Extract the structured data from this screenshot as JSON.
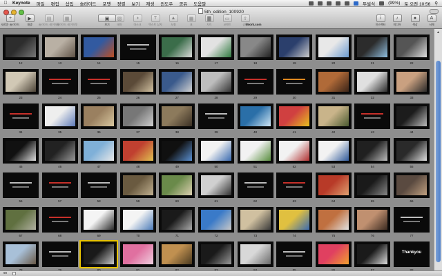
{
  "menubar": {
    "app": "Keynote",
    "items": [
      "파일",
      "편집",
      "삽입",
      "슬라이드",
      "포맷",
      "정렬",
      "보기",
      "재생",
      "윈도우",
      "공유",
      "도움말"
    ],
    "input_method": "두벌식",
    "battery": "(99%)",
    "clock": "토 오전 10:56"
  },
  "window": {
    "title": "5th_edition_100920",
    "iwork_label": "iWork.com"
  },
  "toolbar": [
    {
      "label": "새로운 슬라이드",
      "icon": "new-slide-icon",
      "enabled": true
    },
    {
      "label": "재생",
      "icon": "play-icon",
      "enabled": true
    },
    {
      "label": "슬라이드 레이아웃",
      "icon": "layout-icon",
      "enabled": false
    },
    {
      "label": "슬라이드 레이아웃",
      "icon": "master-icon",
      "enabled": false
    },
    {
      "label": "보기",
      "icon": "view-icon",
      "enabled": true
    },
    {
      "label": "테마",
      "icon": "themes-icon",
      "enabled": false
    },
    {
      "label": "마스크",
      "icon": "mask-icon",
      "enabled": false
    },
    {
      "label": "텍스트 상자",
      "icon": "textbox-icon",
      "enabled": false
    },
    {
      "label": "도형",
      "icon": "shapes-icon",
      "enabled": false
    },
    {
      "label": "표",
      "icon": "table-icon",
      "enabled": false
    },
    {
      "label": "차트",
      "icon": "chart-icon",
      "enabled": false
    },
    {
      "label": "코멘트",
      "icon": "comment-icon",
      "enabled": false
    },
    {
      "label": "공유",
      "icon": "share-icon",
      "enabled": false
    },
    {
      "label": "인스펙터",
      "icon": "inspector-icon",
      "enabled": true
    },
    {
      "label": "미디어",
      "icon": "media-icon",
      "enabled": true
    },
    {
      "label": "색상",
      "icon": "colors-icon",
      "enabled": true
    },
    {
      "label": "서체",
      "icon": "fonts-icon",
      "enabled": true
    }
  ],
  "slides": [
    {
      "n": "12",
      "bg": "#0a0a0a",
      "art": "gradient",
      "c1": "#2d2d2d",
      "c2": "#777777"
    },
    {
      "n": "13",
      "bg": "#0a0a0a",
      "art": "photo",
      "c1": "#b9b0a4",
      "c2": "#5f5246"
    },
    {
      "n": "14",
      "bg": "#0a0a0a",
      "art": "photo",
      "c1": "#325aa0",
      "c2": "#bf4f22"
    },
    {
      "n": "15",
      "bg": "#0a0a0a",
      "art": "text"
    },
    {
      "n": "16",
      "bg": "#0a0a0a",
      "art": "photo",
      "c1": "#3b6d4a",
      "c2": "#d9d9d9"
    },
    {
      "n": "17",
      "bg": "#0a0a0a",
      "art": "photo",
      "c1": "#e2e2e2",
      "c2": "#2f7a3f"
    },
    {
      "n": "18",
      "bg": "#0a0a0a",
      "art": "photo",
      "c1": "#888888",
      "c2": "#222222"
    },
    {
      "n": "19",
      "bg": "#0a0a0a",
      "art": "photo",
      "c1": "#2b3f6c",
      "c2": "#cccccc"
    },
    {
      "n": "20",
      "bg": "#0a0a0a",
      "art": "photo",
      "c1": "#e8e8e8",
      "c2": "#6a9ad0"
    },
    {
      "n": "21",
      "bg": "#0a0a0a",
      "art": "photo",
      "c1": "#2c2c2c",
      "c2": "#8fbfe0"
    },
    {
      "n": "22",
      "bg": "#0a0a0a",
      "art": "photo",
      "c1": "#555555",
      "c2": "#dddddd"
    },
    {
      "n": "23",
      "bg": "#0a0a0a",
      "art": "photo",
      "c1": "#d1c8b5",
      "c2": "#4c4438"
    },
    {
      "n": "24",
      "bg": "#0a0a0a",
      "art": "text",
      "tone": "red"
    },
    {
      "n": "25",
      "bg": "#0a0a0a",
      "art": "text",
      "tone": "red"
    },
    {
      "n": "26",
      "bg": "#0a0a0a",
      "art": "photo",
      "c1": "#5b4a38",
      "c2": "#d0c0a0"
    },
    {
      "n": "27",
      "bg": "#0a0a0a",
      "art": "photo",
      "c1": "#3a5a8c",
      "c2": "#d0d0d0"
    },
    {
      "n": "28",
      "bg": "#0a0a0a",
      "art": "photo",
      "c1": "#bdbdbd",
      "c2": "#333333"
    },
    {
      "n": "29",
      "bg": "#0a0a0a",
      "art": "text",
      "tone": "red"
    },
    {
      "n": "30",
      "bg": "#0a0a0a",
      "art": "text",
      "tone": "orange"
    },
    {
      "n": "31",
      "bg": "#0a0a0a",
      "art": "photo",
      "c1": "#b06a38",
      "c2": "#3a2418"
    },
    {
      "n": "32",
      "bg": "#0a0a0a",
      "art": "photo",
      "c1": "#e0e0e0",
      "c2": "#2a2a2a"
    },
    {
      "n": "33",
      "bg": "#0a0a0a",
      "art": "photo",
      "c1": "#c9a080",
      "c2": "#2a2a2a"
    },
    {
      "n": "34",
      "bg": "#0a0a0a",
      "art": "text",
      "tone": "red"
    },
    {
      "n": "35",
      "bg": "#0a0a0a",
      "art": "photo",
      "c1": "#eeeeee",
      "c2": "#5d7ab8"
    },
    {
      "n": "36",
      "bg": "#0a0a0a",
      "art": "photo",
      "c1": "#9a8060",
      "c2": "#d9c8a0"
    },
    {
      "n": "37",
      "bg": "#0a0a0a",
      "art": "photo",
      "c1": "#777777",
      "c2": "#cfcfcf"
    },
    {
      "n": "38",
      "bg": "#0a0a0a",
      "art": "photo",
      "c1": "#8c7a5c",
      "c2": "#3b3024"
    },
    {
      "n": "39",
      "bg": "#0a0a0a",
      "art": "text"
    },
    {
      "n": "40",
      "bg": "#0a0a0a",
      "art": "photo",
      "c1": "#2a6fa8",
      "c2": "#cfe6f5"
    },
    {
      "n": "41",
      "bg": "#0a0a0a",
      "art": "photo",
      "c1": "#d04040",
      "c2": "#e8c020"
    },
    {
      "n": "42",
      "bg": "#0a0a0a",
      "art": "photo",
      "c1": "#c9b48a",
      "c2": "#4a5a30"
    },
    {
      "n": "43",
      "bg": "#0a0a0a",
      "art": "text",
      "tone": "red"
    },
    {
      "n": "44",
      "bg": "#0a0a0a",
      "art": "photo",
      "c1": "#1c1c1c",
      "c2": "#bbbbbb"
    },
    {
      "n": "45",
      "bg": "#0a0a0a",
      "art": "photo",
      "c1": "#111111",
      "c2": "#dddddd"
    },
    {
      "n": "46",
      "bg": "#0a0a0a",
      "art": "photo",
      "c1": "#222222",
      "c2": "#999999"
    },
    {
      "n": "47",
      "bg": "#0a0a0a",
      "art": "photo",
      "c1": "#7fb0d8",
      "c2": "#e8e8e8"
    },
    {
      "n": "48",
      "bg": "#0a0a0a",
      "art": "photo",
      "c1": "#c04030",
      "c2": "#e0c050"
    },
    {
      "n": "49",
      "bg": "#0a0a0a",
      "art": "photo",
      "c1": "#101010",
      "c2": "#5a8fd0"
    },
    {
      "n": "50",
      "bg": "#0a0a0a",
      "art": "photo",
      "c1": "#f2f2f2",
      "c2": "#3a6ab0"
    },
    {
      "n": "51",
      "bg": "#0a0a0a",
      "art": "photo",
      "c1": "#f2f2f2",
      "c2": "#5a8f40"
    },
    {
      "n": "52",
      "bg": "#0a0a0a",
      "art": "photo",
      "c1": "#f2f2f2",
      "c2": "#b03030"
    },
    {
      "n": "53",
      "bg": "#0a0a0a",
      "art": "photo",
      "c1": "#f2f2f2",
      "c2": "#305a9a"
    },
    {
      "n": "54",
      "bg": "#0a0a0a",
      "art": "photo",
      "c1": "#202020",
      "c2": "#bbbbbb"
    },
    {
      "n": "55",
      "bg": "#0a0a0a",
      "art": "photo",
      "c1": "#2a2a2a",
      "c2": "#dddddd"
    },
    {
      "n": "56",
      "bg": "#0a0a0a",
      "art": "text"
    },
    {
      "n": "57",
      "bg": "#0a0a0a",
      "art": "text",
      "tone": "red"
    },
    {
      "n": "58",
      "bg": "#0a0a0a",
      "art": "text"
    },
    {
      "n": "59",
      "bg": "#0a0a0a",
      "art": "photo",
      "c1": "#6a5a40",
      "c2": "#c0b090"
    },
    {
      "n": "60",
      "bg": "#0a0a0a",
      "art": "photo",
      "c1": "#6a8a4a",
      "c2": "#dcd0b0"
    },
    {
      "n": "61",
      "bg": "#0a0a0a",
      "art": "photo",
      "c1": "#d0d0d0",
      "c2": "#303030"
    },
    {
      "n": "62",
      "bg": "#0a0a0a",
      "art": "text"
    },
    {
      "n": "63",
      "bg": "#0a0a0a",
      "art": "text",
      "tone": "red"
    },
    {
      "n": "64",
      "bg": "#0a0a0a",
      "art": "photo",
      "c1": "#b83a28",
      "c2": "#e0a070"
    },
    {
      "n": "65",
      "bg": "#0a0a0a",
      "art": "photo",
      "c1": "#1a1a1a",
      "c2": "#888888"
    },
    {
      "n": "66",
      "bg": "#0a0a0a",
      "art": "photo",
      "c1": "#5a4a40",
      "c2": "#c0a080"
    },
    {
      "n": "67",
      "bg": "#0a0a0a",
      "art": "photo",
      "c1": "#607040",
      "c2": "#b0b0a0"
    },
    {
      "n": "68",
      "bg": "#0a0a0a",
      "art": "text",
      "tone": "red"
    },
    {
      "n": "69",
      "bg": "#0a0a0a",
      "art": "photo",
      "c1": "#f4f4f4",
      "c2": "#2a2a2a"
    },
    {
      "n": "70",
      "bg": "#0a0a0a",
      "art": "photo",
      "c1": "#f4f4f4",
      "c2": "#4a7ab8"
    },
    {
      "n": "71",
      "bg": "#0a0a0a",
      "art": "photo",
      "c1": "#1a1a1a",
      "c2": "#aaaaaa"
    },
    {
      "n": "72",
      "bg": "#0a0a0a",
      "art": "photo",
      "c1": "#3a7ac8",
      "c2": "#c8c8c8"
    },
    {
      "n": "73",
      "bg": "#0a0a0a",
      "art": "photo",
      "c1": "#d0c0a0",
      "c2": "#3a3a3a"
    },
    {
      "n": "74",
      "bg": "#0a0a0a",
      "art": "photo",
      "c1": "#e0c040",
      "c2": "#3a6ab0"
    },
    {
      "n": "75",
      "bg": "#0a0a0a",
      "art": "photo",
      "c1": "#c07040",
      "c2": "#e0e0e0"
    },
    {
      "n": "76",
      "bg": "#0a0a0a",
      "art": "photo",
      "c1": "#c09070",
      "c2": "#3a2a20"
    },
    {
      "n": "77",
      "bg": "#0a0a0a",
      "art": "text"
    },
    {
      "n": "78",
      "bg": "#0a0a0a",
      "art": "photo",
      "c1": "#a8c0d8",
      "c2": "#6a5a48"
    },
    {
      "n": "79",
      "bg": "#0a0a0a",
      "art": "text"
    },
    {
      "n": "80",
      "bg": "#0a0a0a",
      "art": "photo",
      "c1": "#1a1a1a",
      "c2": "#c8c8c8",
      "selected": true
    },
    {
      "n": "81",
      "bg": "#0a0a0a",
      "art": "photo",
      "c1": "#e070a0",
      "c2": "#f0d0e0"
    },
    {
      "n": "82",
      "bg": "#0a0a0a",
      "art": "photo",
      "c1": "#c09050",
      "c2": "#4a3a20"
    },
    {
      "n": "83",
      "bg": "#0a0a0a",
      "art": "photo",
      "c1": "#1a1a1a",
      "c2": "#999999"
    },
    {
      "n": "84",
      "bg": "#0a0a0a",
      "art": "photo",
      "c1": "#d8d8d8",
      "c2": "#6a6a6a"
    },
    {
      "n": "85",
      "bg": "#0a0a0a",
      "art": "text"
    },
    {
      "n": "86",
      "bg": "#0a0a0a",
      "art": "photo",
      "c1": "#e04060",
      "c2": "#f0a030"
    },
    {
      "n": "87",
      "bg": "#0a0a0a",
      "art": "photo",
      "c1": "#1a1a1a",
      "c2": "#dddddd"
    },
    {
      "n": "88",
      "bg": "#0a0a0a",
      "art": "thankyou",
      "title": "Thankyou"
    }
  ],
  "status": {
    "zoom": "90"
  }
}
